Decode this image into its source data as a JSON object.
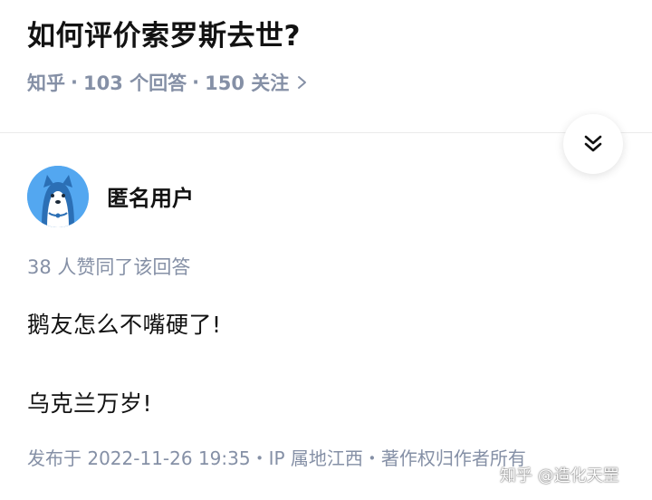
{
  "question": {
    "title": "如何评价索罗斯去世?",
    "source": "知乎",
    "dot": "·",
    "answers": "103 个回答",
    "followers": "150 关注"
  },
  "author": {
    "name": "匿名用户",
    "avatar_color": "#53a7f0"
  },
  "answer": {
    "votes": "38 人赞同了该回答",
    "paragraphs": [
      "鹅友怎么不嘴硬了!",
      "乌克兰万岁!"
    ],
    "footer": "发布于 2022-11-26 19:35・IP 属地江西・著作权归作者所有"
  },
  "watermark": "知乎 @造化天罡",
  "colors": {
    "meta_gray": "#8590a6",
    "text": "#121212",
    "divider": "#ebebeb"
  },
  "icons": {
    "meta_chevron": "chevron-right-icon",
    "collapse": "double-chevron-down-icon",
    "avatar": "husky-avatar-icon"
  }
}
